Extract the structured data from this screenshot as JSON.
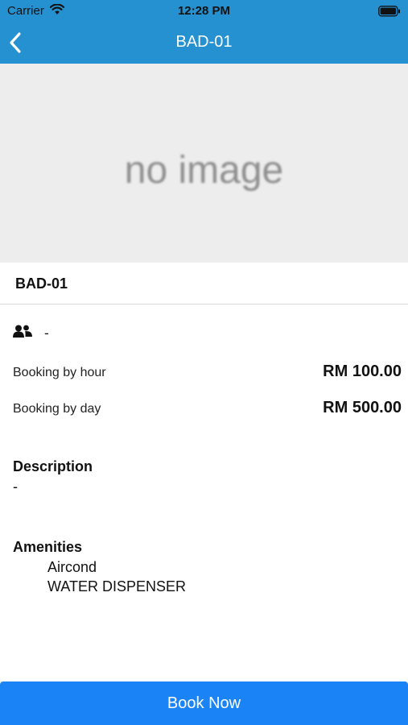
{
  "status_bar": {
    "carrier": "Carrier",
    "time": "12:28 PM"
  },
  "nav": {
    "title": "BAD-01",
    "back_icon": "chevron-left-icon"
  },
  "image": {
    "placeholder_text": "no image"
  },
  "item": {
    "title": "BAD-01",
    "capacity_icon": "people-icon",
    "capacity": "-"
  },
  "pricing": {
    "hour_label": "Booking by hour",
    "hour_price": "RM 100.00",
    "day_label": "Booking by day",
    "day_price": "RM 500.00"
  },
  "description": {
    "heading": "Description",
    "text": "-"
  },
  "amenities": {
    "heading": "Amenities",
    "items": [
      "Aircond",
      "WATER DISPENSER"
    ]
  },
  "actions": {
    "book_label": "Book Now"
  },
  "colors": {
    "nav_bar": "#2591d1",
    "button": "#1a83f5"
  }
}
